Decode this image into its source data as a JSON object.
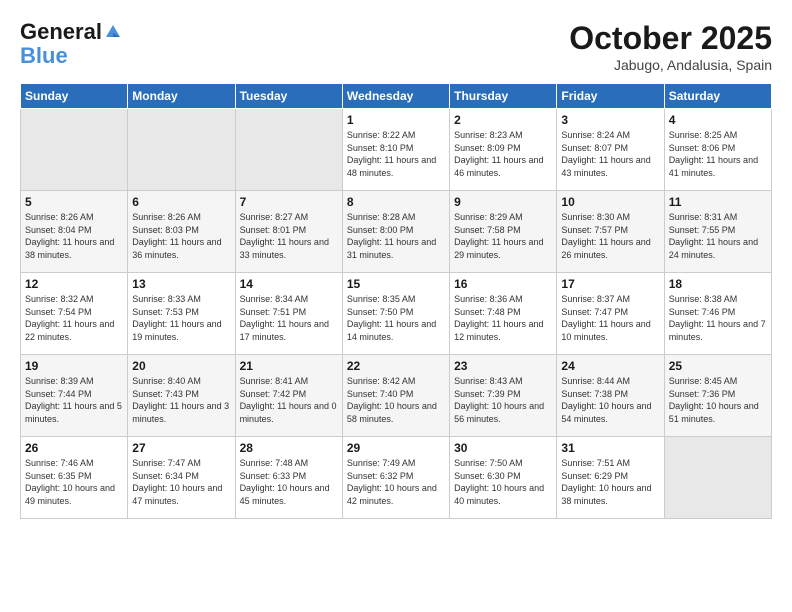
{
  "logo": {
    "line1": "General",
    "line2": "Blue"
  },
  "header": {
    "month": "October 2025",
    "location": "Jabugo, Andalusia, Spain"
  },
  "weekdays": [
    "Sunday",
    "Monday",
    "Tuesday",
    "Wednesday",
    "Thursday",
    "Friday",
    "Saturday"
  ],
  "weeks": [
    [
      {
        "day": "",
        "info": ""
      },
      {
        "day": "",
        "info": ""
      },
      {
        "day": "",
        "info": ""
      },
      {
        "day": "1",
        "info": "Sunrise: 8:22 AM\nSunset: 8:10 PM\nDaylight: 11 hours\nand 48 minutes."
      },
      {
        "day": "2",
        "info": "Sunrise: 8:23 AM\nSunset: 8:09 PM\nDaylight: 11 hours\nand 46 minutes."
      },
      {
        "day": "3",
        "info": "Sunrise: 8:24 AM\nSunset: 8:07 PM\nDaylight: 11 hours\nand 43 minutes."
      },
      {
        "day": "4",
        "info": "Sunrise: 8:25 AM\nSunset: 8:06 PM\nDaylight: 11 hours\nand 41 minutes."
      }
    ],
    [
      {
        "day": "5",
        "info": "Sunrise: 8:26 AM\nSunset: 8:04 PM\nDaylight: 11 hours\nand 38 minutes."
      },
      {
        "day": "6",
        "info": "Sunrise: 8:26 AM\nSunset: 8:03 PM\nDaylight: 11 hours\nand 36 minutes."
      },
      {
        "day": "7",
        "info": "Sunrise: 8:27 AM\nSunset: 8:01 PM\nDaylight: 11 hours\nand 33 minutes."
      },
      {
        "day": "8",
        "info": "Sunrise: 8:28 AM\nSunset: 8:00 PM\nDaylight: 11 hours\nand 31 minutes."
      },
      {
        "day": "9",
        "info": "Sunrise: 8:29 AM\nSunset: 7:58 PM\nDaylight: 11 hours\nand 29 minutes."
      },
      {
        "day": "10",
        "info": "Sunrise: 8:30 AM\nSunset: 7:57 PM\nDaylight: 11 hours\nand 26 minutes."
      },
      {
        "day": "11",
        "info": "Sunrise: 8:31 AM\nSunset: 7:55 PM\nDaylight: 11 hours\nand 24 minutes."
      }
    ],
    [
      {
        "day": "12",
        "info": "Sunrise: 8:32 AM\nSunset: 7:54 PM\nDaylight: 11 hours\nand 22 minutes."
      },
      {
        "day": "13",
        "info": "Sunrise: 8:33 AM\nSunset: 7:53 PM\nDaylight: 11 hours\nand 19 minutes."
      },
      {
        "day": "14",
        "info": "Sunrise: 8:34 AM\nSunset: 7:51 PM\nDaylight: 11 hours\nand 17 minutes."
      },
      {
        "day": "15",
        "info": "Sunrise: 8:35 AM\nSunset: 7:50 PM\nDaylight: 11 hours\nand 14 minutes."
      },
      {
        "day": "16",
        "info": "Sunrise: 8:36 AM\nSunset: 7:48 PM\nDaylight: 11 hours\nand 12 minutes."
      },
      {
        "day": "17",
        "info": "Sunrise: 8:37 AM\nSunset: 7:47 PM\nDaylight: 11 hours\nand 10 minutes."
      },
      {
        "day": "18",
        "info": "Sunrise: 8:38 AM\nSunset: 7:46 PM\nDaylight: 11 hours\nand 7 minutes."
      }
    ],
    [
      {
        "day": "19",
        "info": "Sunrise: 8:39 AM\nSunset: 7:44 PM\nDaylight: 11 hours\nand 5 minutes."
      },
      {
        "day": "20",
        "info": "Sunrise: 8:40 AM\nSunset: 7:43 PM\nDaylight: 11 hours\nand 3 minutes."
      },
      {
        "day": "21",
        "info": "Sunrise: 8:41 AM\nSunset: 7:42 PM\nDaylight: 11 hours\nand 0 minutes."
      },
      {
        "day": "22",
        "info": "Sunrise: 8:42 AM\nSunset: 7:40 PM\nDaylight: 10 hours\nand 58 minutes."
      },
      {
        "day": "23",
        "info": "Sunrise: 8:43 AM\nSunset: 7:39 PM\nDaylight: 10 hours\nand 56 minutes."
      },
      {
        "day": "24",
        "info": "Sunrise: 8:44 AM\nSunset: 7:38 PM\nDaylight: 10 hours\nand 54 minutes."
      },
      {
        "day": "25",
        "info": "Sunrise: 8:45 AM\nSunset: 7:36 PM\nDaylight: 10 hours\nand 51 minutes."
      }
    ],
    [
      {
        "day": "26",
        "info": "Sunrise: 7:46 AM\nSunset: 6:35 PM\nDaylight: 10 hours\nand 49 minutes."
      },
      {
        "day": "27",
        "info": "Sunrise: 7:47 AM\nSunset: 6:34 PM\nDaylight: 10 hours\nand 47 minutes."
      },
      {
        "day": "28",
        "info": "Sunrise: 7:48 AM\nSunset: 6:33 PM\nDaylight: 10 hours\nand 45 minutes."
      },
      {
        "day": "29",
        "info": "Sunrise: 7:49 AM\nSunset: 6:32 PM\nDaylight: 10 hours\nand 42 minutes."
      },
      {
        "day": "30",
        "info": "Sunrise: 7:50 AM\nSunset: 6:30 PM\nDaylight: 10 hours\nand 40 minutes."
      },
      {
        "day": "31",
        "info": "Sunrise: 7:51 AM\nSunset: 6:29 PM\nDaylight: 10 hours\nand 38 minutes."
      },
      {
        "day": "",
        "info": ""
      }
    ]
  ]
}
